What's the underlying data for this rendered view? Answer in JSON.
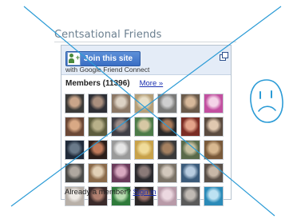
{
  "widget": {
    "title": "Centsational Friends"
  },
  "gfc": {
    "join_label": "Join this site",
    "subtitle": "with Google Friend Connect",
    "members_label": "Members (11396)",
    "more_label": "More »",
    "footer_prefix": "Already a member?",
    "signin_label": "Sign in"
  },
  "members": [
    {
      "c1": "#3b3a38",
      "c2": "#c9a58a"
    },
    {
      "c1": "#2e2f35",
      "c2": "#a98f7e"
    },
    {
      "c1": "#8b7765",
      "c2": "#ddd2c4"
    },
    {
      "c1": "#b59f78",
      "c2": "#e8dfc8"
    },
    {
      "c1": "#7a7a78",
      "c2": "#cfcfcf"
    },
    {
      "c1": "#6a5a4a",
      "c2": "#d6b89a"
    },
    {
      "c1": "#c24fa0",
      "c2": "#f4d4e8"
    },
    {
      "c1": "#6b4836",
      "c2": "#d9a985"
    },
    {
      "c1": "#5d5d3e",
      "c2": "#b8b08a"
    },
    {
      "c1": "#3f3f46",
      "c2": "#9a8a86"
    },
    {
      "c1": "#4c7b48",
      "c2": "#d7c8a4"
    },
    {
      "c1": "#2a2a2a",
      "c2": "#a87a5a"
    },
    {
      "c1": "#7a2c24",
      "c2": "#e4a38a"
    },
    {
      "c1": "#5b4b3f",
      "c2": "#e0c8b0"
    },
    {
      "c1": "#1f2a3a",
      "c2": "#6a7a8a"
    },
    {
      "c1": "#2b1e1a",
      "c2": "#c07a5a"
    },
    {
      "c1": "#9a9a9a",
      "c2": "#e6e6e6"
    },
    {
      "c1": "#c8a24a",
      "c2": "#f0dc9a"
    },
    {
      "c1": "#3a3a3a",
      "c2": "#a48060"
    },
    {
      "c1": "#5a6a4a",
      "c2": "#c6c0a0"
    },
    {
      "c1": "#7a5a3a",
      "c2": "#d8b890"
    },
    {
      "c1": "#4a4a48",
      "c2": "#b0a8a0"
    },
    {
      "c1": "#8a6a4a",
      "c2": "#e2d0b6"
    },
    {
      "c1": "#6a3a5a",
      "c2": "#d8a8c0"
    },
    {
      "c1": "#2a2a2e",
      "c2": "#8a7a78"
    },
    {
      "c1": "#7a7266",
      "c2": "#d2c8bc"
    },
    {
      "c1": "#3a5a7a",
      "c2": "#b8cce0"
    },
    {
      "c1": "#5a5048",
      "c2": "#c8b8a8"
    },
    {
      "c1": "#b8b0a8",
      "c2": "#eeeae6"
    },
    {
      "c1": "#3a2a2a",
      "c2": "#b08070"
    },
    {
      "c1": "#2e7a3a",
      "c2": "#b8dcb0"
    },
    {
      "c1": "#2a2626",
      "c2": "#9a706a"
    },
    {
      "c1": "#b89aa8",
      "c2": "#ecd8e0"
    },
    {
      "c1": "#5a5a5a",
      "c2": "#c0bab4"
    },
    {
      "c1": "#2a8ab8",
      "c2": "#bde2f2"
    }
  ],
  "colors": {
    "cross_line": "#2b9bd6",
    "sad_face": "#2b9bd6"
  },
  "icons": {
    "join": "friend-connect-icon",
    "popout": "popout-icon",
    "sad_face": "sad-face-doodle"
  }
}
